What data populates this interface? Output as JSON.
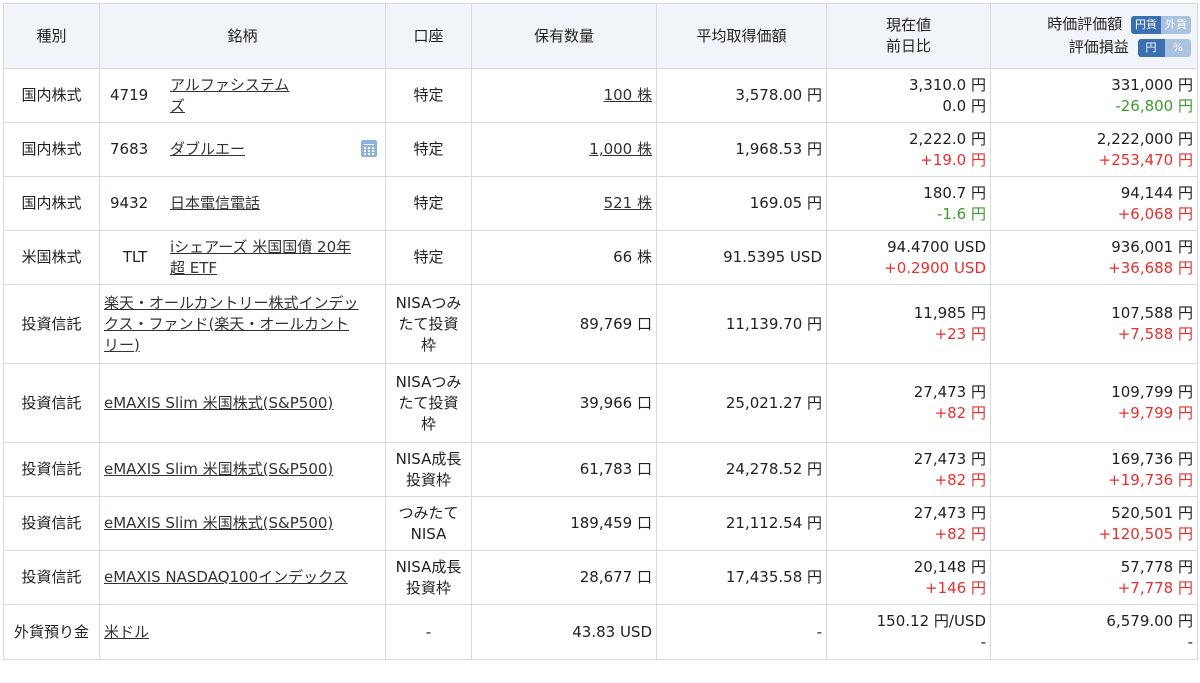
{
  "headers": {
    "type": "種別",
    "name": "銘柄",
    "account": "口座",
    "quantity": "保有数量",
    "avg_cost": "平均取得価額",
    "price_line1": "現在値",
    "price_line2": "前日比",
    "value_line1": "時価評価額",
    "value_line2": "評価損益",
    "toggle_jpy": "円貨",
    "toggle_fx": "外貨",
    "toggle_yen": "円",
    "toggle_pct": "%"
  },
  "rows": [
    {
      "type": "国内株式",
      "code": "4719",
      "name_l1": "アルファシステム",
      "name_l2": "ズ",
      "account": "特定",
      "qty": "100 株",
      "avg": "3,578.00 円",
      "price": "3,310.0 円",
      "change": "0.0 円",
      "value": "331,000 円",
      "pl": "-26,800 円"
    },
    {
      "type": "国内株式",
      "code": "7683",
      "name": "ダブルエー",
      "account": "特定",
      "qty": "1,000 株",
      "avg": "1,968.53 円",
      "price": "2,222.0 円",
      "change": "+19.0 円",
      "value": "2,222,000 円",
      "pl": "+253,470 円"
    },
    {
      "type": "国内株式",
      "code": "9432",
      "name": "日本電信電話",
      "account": "特定",
      "qty": "521 株",
      "avg": "169.05 円",
      "price": "180.7 円",
      "change": "-1.6 円",
      "value": "94,144 円",
      "pl": "+6,068 円"
    },
    {
      "type": "米国株式",
      "code": "TLT",
      "name_l1": "iシェアーズ 米国国債 20年",
      "name_l2": "超 ETF",
      "account": "特定",
      "qty": "66 株",
      "avg": "91.5395 USD",
      "price": "94.4700 USD",
      "change": "+0.2900 USD",
      "value": "936,001 円",
      "pl": "+36,688 円"
    },
    {
      "type": "投資信託",
      "name_l1": "楽天・オールカントリー株式インデッ",
      "name_l2": "クス・ファンド(楽天・オールカント",
      "name_l3": "リー)",
      "acct_l1": "NISAつみ",
      "acct_l2": "たて投資",
      "acct_l3": "枠",
      "qty": "89,769 口",
      "avg": "11,139.70 円",
      "price": "11,985 円",
      "change": "+23 円",
      "value": "107,588 円",
      "pl": "+7,588 円"
    },
    {
      "type": "投資信託",
      "name": "eMAXIS Slim 米国株式(S&P500)",
      "acct_l1": "NISAつみ",
      "acct_l2": "たて投資",
      "acct_l3": "枠",
      "qty": "39,966 口",
      "avg": "25,021.27 円",
      "price": "27,473 円",
      "change": "+82 円",
      "value": "109,799 円",
      "pl": "+9,799 円"
    },
    {
      "type": "投資信託",
      "name": "eMAXIS Slim 米国株式(S&P500)",
      "acct_l1": "NISA成長",
      "acct_l2": "投資枠",
      "qty": "61,783 口",
      "avg": "24,278.52 円",
      "price": "27,473 円",
      "change": "+82 円",
      "value": "169,736 円",
      "pl": "+19,736 円"
    },
    {
      "type": "投資信託",
      "name": "eMAXIS Slim 米国株式(S&P500)",
      "acct_l1": "つみたて",
      "acct_l2": "NISA",
      "qty": "189,459 口",
      "avg": "21,112.54 円",
      "price": "27,473 円",
      "change": "+82 円",
      "value": "520,501 円",
      "pl": "+120,505 円"
    },
    {
      "type": "投資信託",
      "name": "eMAXIS NASDAQ100インデックス",
      "acct_l1": "NISA成長",
      "acct_l2": "投資枠",
      "qty": "28,677 口",
      "avg": "17,435.58 円",
      "price": "20,148 円",
      "change": "+146 円",
      "value": "57,778 円",
      "pl": "+7,778 円"
    },
    {
      "type": "外貨預り金",
      "name": "米ドル",
      "account": "-",
      "qty": "43.83 USD",
      "avg": "-",
      "price": "150.12 円/USD",
      "change": "-",
      "value": "6,579.00 円",
      "pl": "-"
    }
  ],
  "colors": {
    "positive": "#e5312d",
    "negative": "#3b9b2c",
    "header_bg": "#f1f4f8",
    "toggle_active": "#3b6fb0"
  }
}
